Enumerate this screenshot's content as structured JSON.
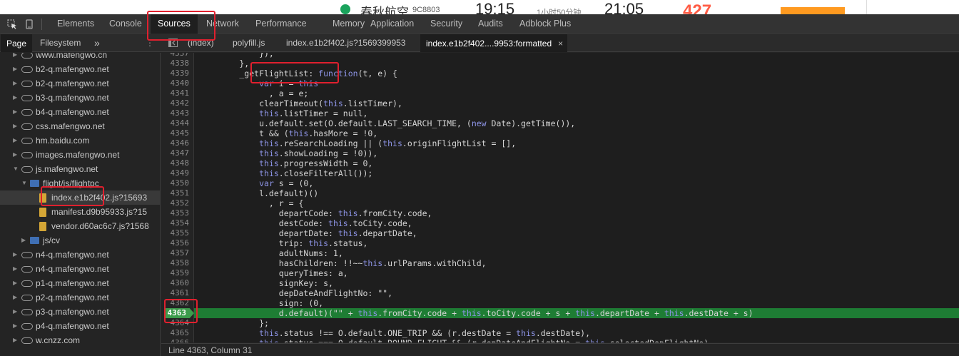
{
  "page": {
    "airline": "春秋航空",
    "flight_no": "9C8803",
    "depart_time": "19:15",
    "duration": "1小时50分钟",
    "arrive_time": "21:05",
    "price": "427"
  },
  "devtools": {
    "main_tabs": [
      "Elements",
      "Console",
      "Sources",
      "Network",
      "Performance",
      "Memory",
      "Application",
      "Security",
      "Audits",
      "Adblock Plus"
    ],
    "active_main_tab": "Sources",
    "nav_tabs": [
      "Page",
      "Filesystem"
    ],
    "nav_more": "»",
    "file_tabs": [
      "(index)",
      "polyfill.js",
      "index.e1b2f402.js?1569399953",
      "index.e1b2f402....9953:formatted"
    ],
    "close_glyph": "×",
    "tree": [
      {
        "label": "www.mafengwo.cn",
        "kind": "domain"
      },
      {
        "label": "b2-q.mafengwo.net",
        "kind": "domain"
      },
      {
        "label": "b2-q.mafengwo.net",
        "kind": "domain"
      },
      {
        "label": "b3-q.mafengwo.net",
        "kind": "domain"
      },
      {
        "label": "b4-q.mafengwo.net",
        "kind": "domain"
      },
      {
        "label": "css.mafengwo.net",
        "kind": "domain"
      },
      {
        "label": "hm.baidu.com",
        "kind": "domain"
      },
      {
        "label": "images.mafengwo.net",
        "kind": "domain"
      },
      {
        "label": "js.mafengwo.net",
        "kind": "domain-open"
      },
      {
        "label": "flight/js/flightpc",
        "kind": "folder-open"
      },
      {
        "label": "index.e1b2f402.js?15693",
        "kind": "file",
        "selected": true
      },
      {
        "label": "manifest.d9b95933.js?15",
        "kind": "file"
      },
      {
        "label": "vendor.d60ac6c7.js?1568",
        "kind": "file"
      },
      {
        "label": "js/cv",
        "kind": "folder"
      },
      {
        "label": "n4-q.mafengwo.net",
        "kind": "domain"
      },
      {
        "label": "n4-q.mafengwo.net",
        "kind": "domain"
      },
      {
        "label": "p1-q.mafengwo.net",
        "kind": "domain"
      },
      {
        "label": "p2-q.mafengwo.net",
        "kind": "domain"
      },
      {
        "label": "p3-q.mafengwo.net",
        "kind": "domain"
      },
      {
        "label": "p4-q.mafengwo.net",
        "kind": "domain"
      },
      {
        "label": "w.cnzz.com",
        "kind": "domain"
      }
    ],
    "code": [
      {
        "n": "4337",
        "t": "            }), "
      },
      {
        "n": "4338",
        "t": "        },"
      },
      {
        "n": "4339",
        "t": "        _getFlightList: function(t, e) {"
      },
      {
        "n": "4340",
        "t": "            var i = this"
      },
      {
        "n": "4341",
        "t": "              , a = e;"
      },
      {
        "n": "4342",
        "t": "            clearTimeout(this.listTimer),"
      },
      {
        "n": "4343",
        "t": "            this.listTimer = null,"
      },
      {
        "n": "4344",
        "t": "            u.default.set(O.default.LAST_SEARCH_TIME, (new Date).getTime()),"
      },
      {
        "n": "4345",
        "t": "            t && (this.hasMore = !0,"
      },
      {
        "n": "4346",
        "t": "            this.reSearchLoading || (this.originFlightList = [],"
      },
      {
        "n": "4347",
        "t": "            this.showLoading = !0)),"
      },
      {
        "n": "4348",
        "t": "            this.progressWidth = 0,"
      },
      {
        "n": "4349",
        "t": "            this.closeFilterAll());"
      },
      {
        "n": "4350",
        "t": "            var s = (0,"
      },
      {
        "n": "4351",
        "t": "            l.default)()"
      },
      {
        "n": "4352",
        "t": "              , r = {"
      },
      {
        "n": "4353",
        "t": "                departCode: this.fromCity.code,"
      },
      {
        "n": "4354",
        "t": "                destCode: this.toCity.code,"
      },
      {
        "n": "4355",
        "t": "                departDate: this.departDate,"
      },
      {
        "n": "4356",
        "t": "                trip: this.status,"
      },
      {
        "n": "4357",
        "t": "                adultNums: 1,"
      },
      {
        "n": "4358",
        "t": "                hasChildren: !!~~this.urlParams.withChild,"
      },
      {
        "n": "4359",
        "t": "                queryTimes: a,"
      },
      {
        "n": "4360",
        "t": "                signKey: s,"
      },
      {
        "n": "4361",
        "t": "                depDateAndFlightNo: \"\","
      },
      {
        "n": "4362",
        "t": "                sign: (0,"
      },
      {
        "n": "4363",
        "t": "                d.default)(\"\" + this.fromCity.code + this.toCity.code + s + this.departDate + this.destDate + s)",
        "current": true
      },
      {
        "n": "4364",
        "t": "            };"
      },
      {
        "n": "4365",
        "t": "            this.status !== O.default.ONE_TRIP && (r.destDate = this.destDate),"
      },
      {
        "n": "4366",
        "t": "            this.status === O.default.ROUND_FLIGHT && (r.depDateAndFlightNo = this.selectedDepFlightNo)"
      }
    ],
    "status_bar": "Line 4363, Column 31"
  }
}
